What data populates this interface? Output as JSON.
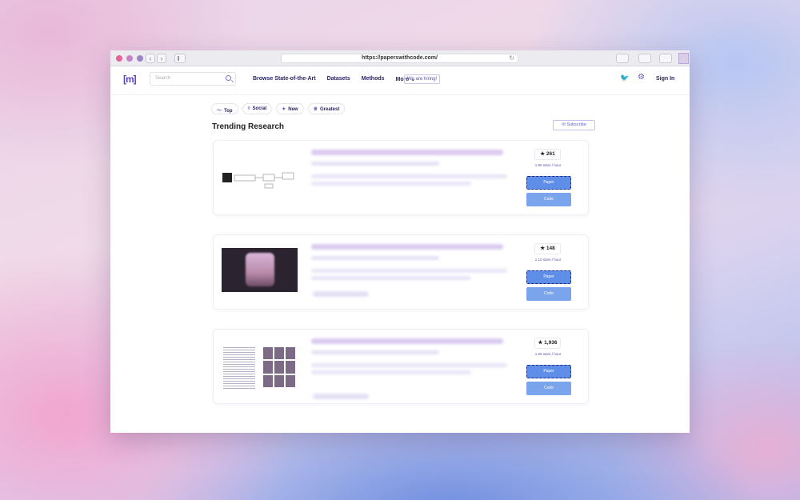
{
  "browser": {
    "url": "https://paperswithcode.com/",
    "reload_glyph": "↻",
    "back_glyph": "‹",
    "forward_glyph": "›"
  },
  "header": {
    "logo": "[m]",
    "search_placeholder": "Search",
    "nav": [
      "Browse State-of-the-Art",
      "Datasets",
      "Methods",
      "More ⌄"
    ],
    "hiring": "We are hiring!",
    "twitter_glyph": "🐦",
    "gear_glyph": "⚙",
    "signin": "Sign In"
  },
  "filters": [
    {
      "icon": "〜",
      "label": "Top"
    },
    {
      "icon": "◊",
      "label": "Social"
    },
    {
      "icon": "✦",
      "label": "New"
    },
    {
      "icon": "♕",
      "label": "Greatest"
    }
  ],
  "main": {
    "title": "Trending Research",
    "subscribe": "✉ Subscribe"
  },
  "papers": [
    {
      "stars": "★ 261",
      "rate": "1.90 stars / hour",
      "paper_label": "Paper",
      "code_label": "Code"
    },
    {
      "stars": "★ 148",
      "rate": "1.10 stars / hour",
      "paper_label": "Paper",
      "code_label": "Code"
    },
    {
      "stars": "★ 1,936",
      "rate": "1.25 stars / hour",
      "paper_label": "Paper",
      "code_label": "Code"
    }
  ]
}
